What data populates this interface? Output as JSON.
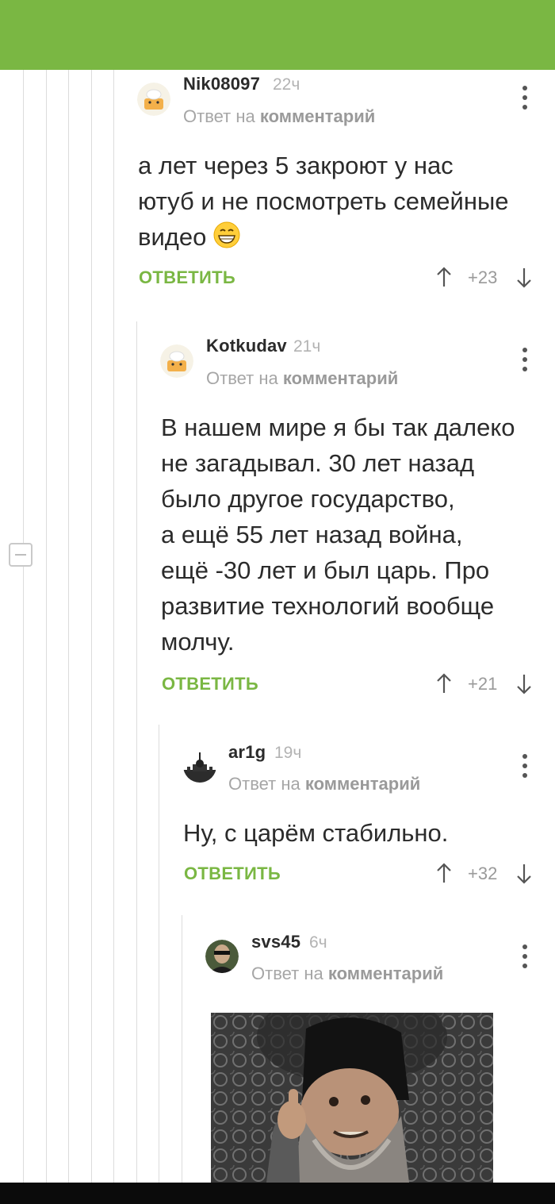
{
  "comments": [
    {
      "username": "Nik08097",
      "time": "22ч",
      "reply_prefix": "Ответ на",
      "reply_target": "комментарий",
      "text_lines": [
        "а лет через 5 закроют у нас",
        "ютуб и не посмотреть семейные",
        "видео"
      ],
      "emoji": "grinning-face-emoji",
      "reply_label": "ОТВЕТИТЬ",
      "rating": "+23"
    },
    {
      "username": "Kotkudav",
      "time": "21ч",
      "reply_prefix": "Ответ на",
      "reply_target": "комментарий",
      "text_lines": [
        "В нашем мире я бы так далеко",
        "не загадывал. 30 лет назад",
        "было другое государство,",
        "а ещё 55 лет назад война,",
        "ещё -30 лет и был царь. Про",
        "развитие технологий вообще",
        "молчу."
      ],
      "reply_label": "ОТВЕТИТЬ",
      "rating": "+21"
    },
    {
      "username": "ar1g",
      "time": "19ч",
      "reply_prefix": "Ответ на",
      "reply_target": "комментарий",
      "text_lines": [
        "Ну, с царём стабильно."
      ],
      "reply_label": "ОТВЕТИТЬ",
      "rating": "+32"
    },
    {
      "username": "svs45",
      "time": "6ч",
      "reply_prefix": "Ответ на",
      "reply_target": "комментарий",
      "image": "meme-image-tsar-ivan"
    }
  ],
  "colors": {
    "brand_green": "#7ab743",
    "text": "#2b2b2b",
    "muted": "#a6a6a6"
  }
}
